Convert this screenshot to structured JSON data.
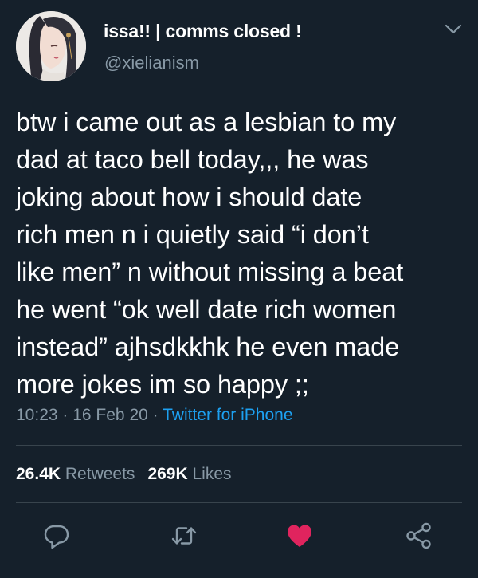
{
  "user": {
    "display_name": "issa!! | comms closed !",
    "handle": "@xielianism"
  },
  "tweet": {
    "text": "btw i came out as a lesbian to my\ndad at taco bell today,,, he was\njoking about how i should date\nrich men n i quietly said “i don’t\nlike men” n without missing a beat\nhe went “ok well date rich women\ninstead” ajhsdkkhk he even made\nmore jokes im so happy ;;",
    "time": "10:23",
    "date": "16 Feb 20",
    "separator": " · ",
    "source": "Twitter for iPhone"
  },
  "stats": {
    "retweets_count": "26.4K",
    "retweets_label": "Retweets",
    "likes_count": "269K",
    "likes_label": "Likes"
  },
  "actions": {
    "reply_icon": "reply-icon",
    "retweet_icon": "retweet-icon",
    "like_icon": "heart-icon",
    "share_icon": "share-icon"
  },
  "colors": {
    "background": "#15202b",
    "secondary_text": "#8899a6",
    "link": "#1da1f2",
    "like": "#e0245e",
    "divider": "#38444d"
  }
}
